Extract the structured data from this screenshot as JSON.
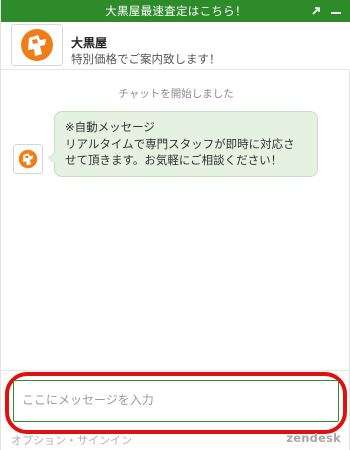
{
  "topbar": {
    "title": "大黒屋最速査定はこちら！",
    "popout_icon": "arrow-up-right-icon",
    "minimize_icon": "minimize-icon",
    "color": "#2e8b2a"
  },
  "header": {
    "name": "大黒屋",
    "subtitle": "特別価格でご案内致します！",
    "logo_icon": "daikokuya-logo-icon",
    "logo_color": "#f07d1a"
  },
  "chat": {
    "system_message": "チャットを開始しました",
    "messages": [
      {
        "lines": [
          "※自動メッセージ",
          "リアルタイムで専門スタッフが即時に対応さ",
          "せて頂きます。お気軽にご相談ください！"
        ]
      }
    ]
  },
  "input": {
    "placeholder": "ここにメッセージを入力",
    "value": ""
  },
  "footer": {
    "options_label": "オプション・サインイン",
    "brand": "zendesk"
  },
  "colors": {
    "accent": "#2e8b2a",
    "bubble": "#e5f1e1",
    "highlight": "#e01010"
  }
}
